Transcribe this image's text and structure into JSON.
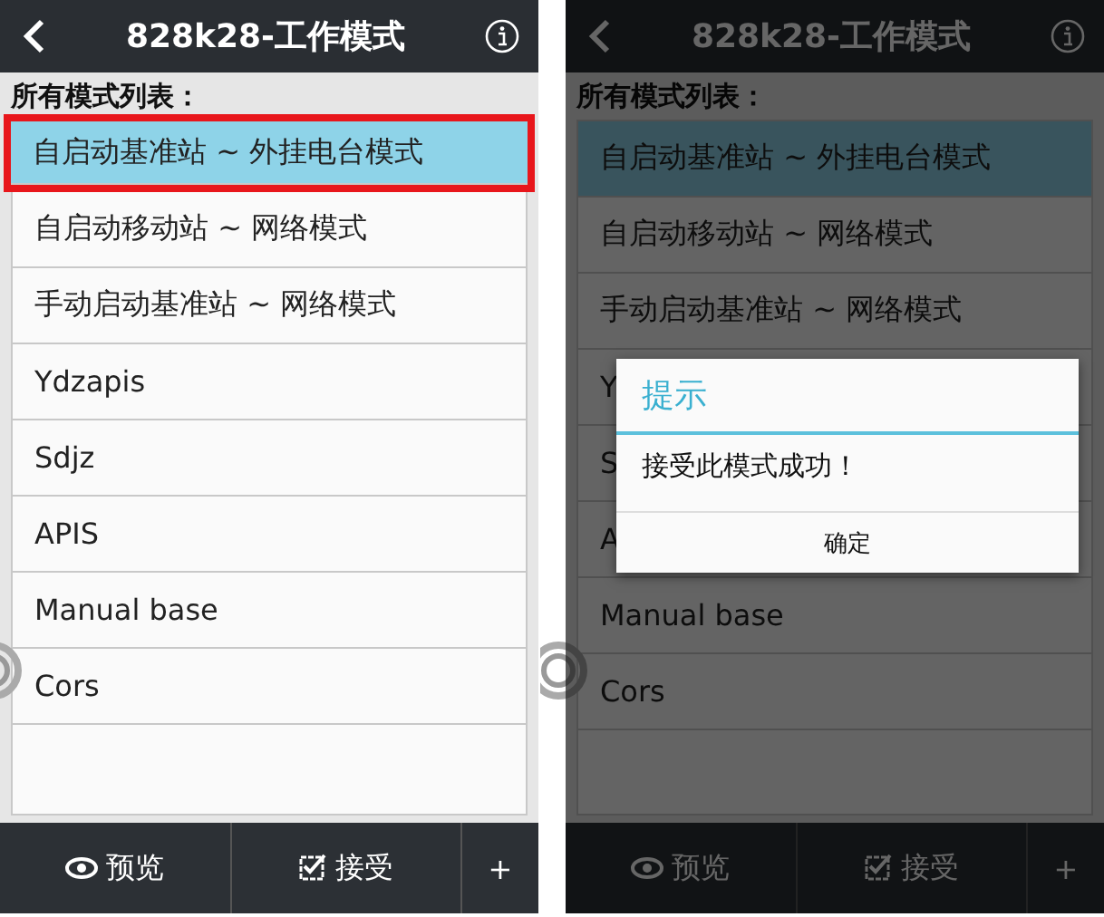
{
  "screens": [
    {
      "title": "828k28-工作模式",
      "list_header": "所有模式列表：",
      "items": [
        {
          "label": "自启动基准站 ~ 外挂电台模式",
          "selected": true,
          "highlighted": true
        },
        {
          "label": "自启动移动站 ~ 网络模式",
          "selected": false,
          "highlighted": false
        },
        {
          "label": "手动启动基准站 ~ 网络模式",
          "selected": false,
          "highlighted": false
        },
        {
          "label": "Ydzapis",
          "selected": false,
          "highlighted": false
        },
        {
          "label": "Sdjz",
          "selected": false,
          "highlighted": false
        },
        {
          "label": "APIS",
          "selected": false,
          "highlighted": false
        },
        {
          "label": "Manual base",
          "selected": false,
          "highlighted": false
        },
        {
          "label": "Cors",
          "selected": false,
          "highlighted": false
        }
      ],
      "buttons": [
        {
          "kind": "preview",
          "label": "预览"
        },
        {
          "kind": "accept",
          "label": "接受"
        },
        {
          "kind": "add",
          "label": "+"
        }
      ]
    },
    {
      "title": "828k28-工作模式",
      "list_header": "所有模式列表：",
      "items": [
        {
          "label": "自启动基准站 ~ 外挂电台模式",
          "selected": true,
          "highlighted": false
        },
        {
          "label": "自启动移动站 ~ 网络模式",
          "selected": false,
          "highlighted": false
        },
        {
          "label": "手动启动基准站 ~ 网络模式",
          "selected": false,
          "highlighted": false
        },
        {
          "label": "Y",
          "selected": false,
          "highlighted": false
        },
        {
          "label": "S",
          "selected": false,
          "highlighted": false
        },
        {
          "label": "A",
          "selected": false,
          "highlighted": false
        },
        {
          "label": "Manual base",
          "selected": false,
          "highlighted": false
        },
        {
          "label": "Cors",
          "selected": false,
          "highlighted": false
        }
      ],
      "buttons": [
        {
          "kind": "preview",
          "label": "预览"
        },
        {
          "kind": "accept",
          "label": "接受"
        },
        {
          "kind": "add",
          "label": "+"
        }
      ],
      "dialog": {
        "title": "提示",
        "message": "接受此模式成功！",
        "button": "确定"
      }
    }
  ]
}
